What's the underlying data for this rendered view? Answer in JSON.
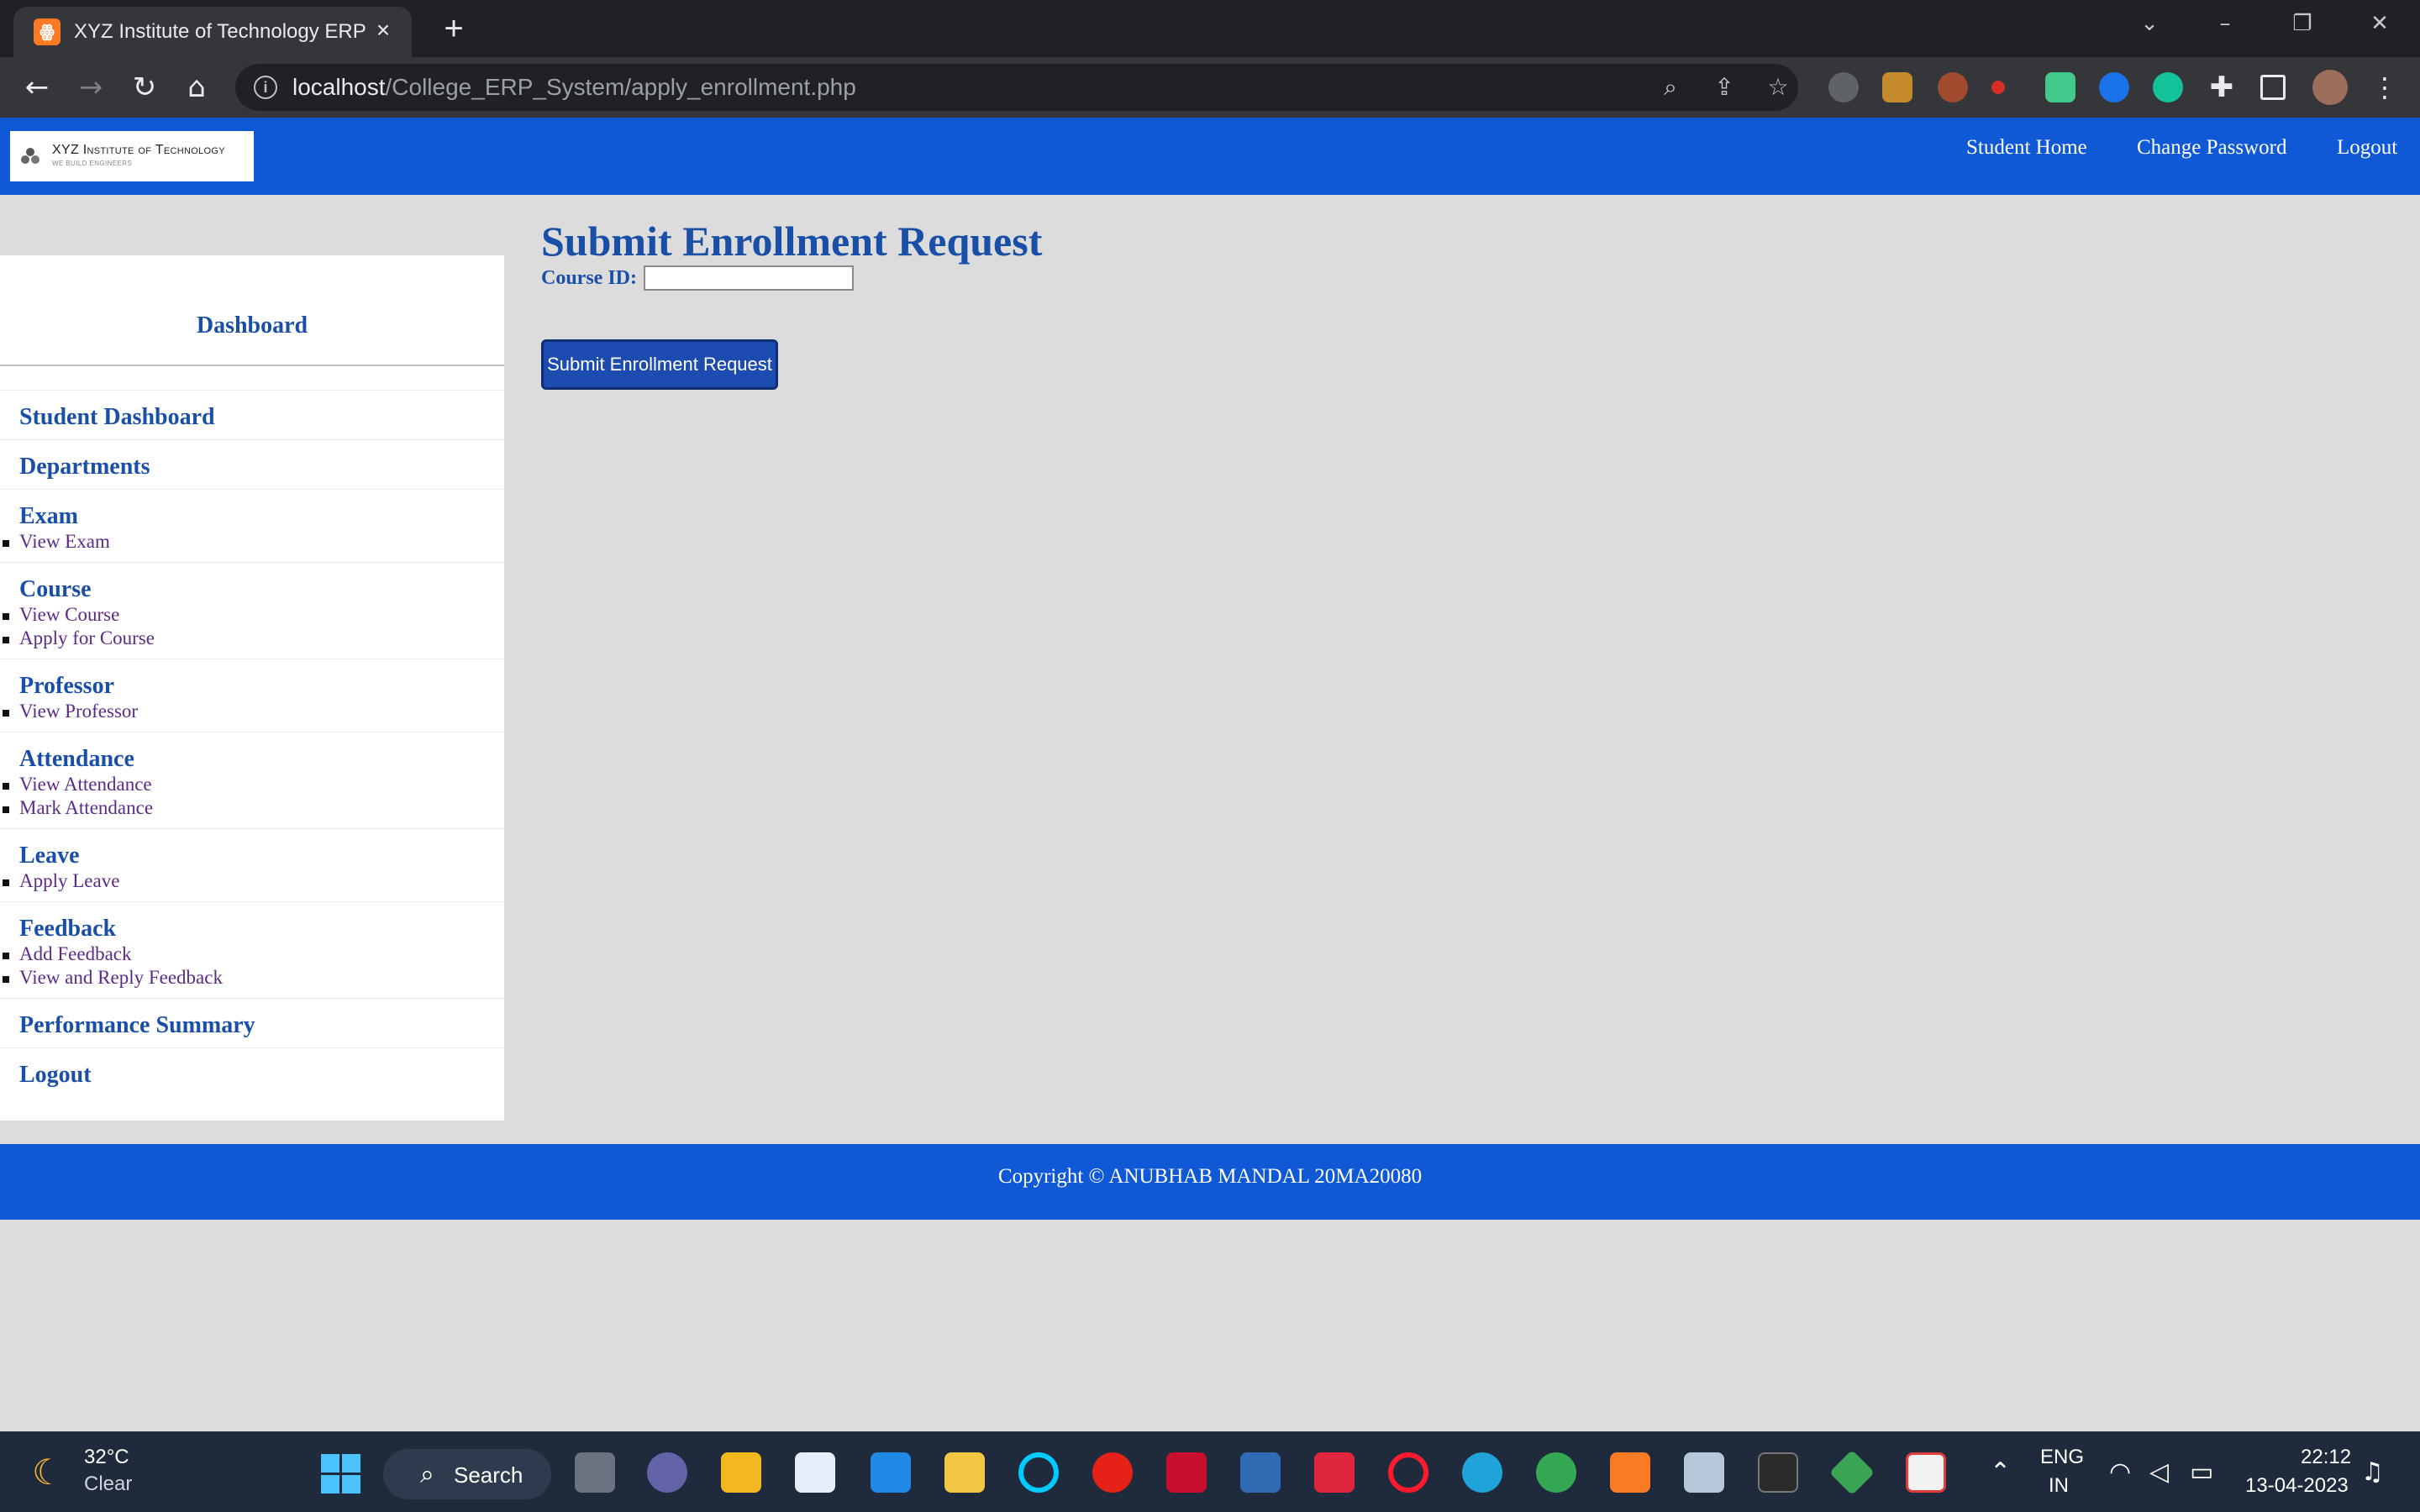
{
  "browser": {
    "tab_title": "XYZ Institute of Technology ERP",
    "tab_favicon_glyph": "ꙮ",
    "new_tab_glyph": "+",
    "url_host": "localhost",
    "url_path": "/College_ERP_System/apply_enrollment.php"
  },
  "header": {
    "logo_name": "XYZ Institute of Technology",
    "logo_tagline": "WE BUILD ENGINEERS",
    "nav": [
      "Student Home",
      "Change Password",
      "Logout"
    ]
  },
  "sidebar": {
    "heading": "Dashboard",
    "sections": [
      {
        "title": "Student Dashboard",
        "items": []
      },
      {
        "title": "Departments",
        "items": []
      },
      {
        "title": "Exam",
        "items": [
          "View Exam"
        ]
      },
      {
        "title": "Course",
        "items": [
          "View Course",
          "Apply for Course"
        ]
      },
      {
        "title": "Professor",
        "items": [
          "View Professor"
        ]
      },
      {
        "title": "Attendance",
        "items": [
          "View Attendance",
          "Mark Attendance"
        ]
      },
      {
        "title": "Leave",
        "items": [
          "Apply Leave"
        ]
      },
      {
        "title": "Feedback",
        "items": [
          "Add Feedback",
          "View and Reply Feedback"
        ]
      },
      {
        "title": "Performance Summary",
        "items": []
      },
      {
        "title": "Logout",
        "items": []
      }
    ]
  },
  "main": {
    "title": "Submit Enrollment Request",
    "course_label": "Course ID:",
    "course_value": "",
    "submit_label": "Submit Enrollment Request"
  },
  "footer": {
    "text": "Copyright © ANUBHAB MANDAL 20MA20080"
  },
  "taskbar": {
    "temperature": "32°C",
    "condition": "Clear",
    "search_label": "Search",
    "language_top": "ENG",
    "language_bottom": "IN",
    "time": "22:12",
    "date": "13-04-2023"
  },
  "colors": {
    "header_blue": "#1059d6",
    "heading_blue": "#1a4fa8",
    "link_purple": "#5b2a86",
    "button_blue": "#1d4cb0",
    "page_bg": "#dcdcdc"
  }
}
